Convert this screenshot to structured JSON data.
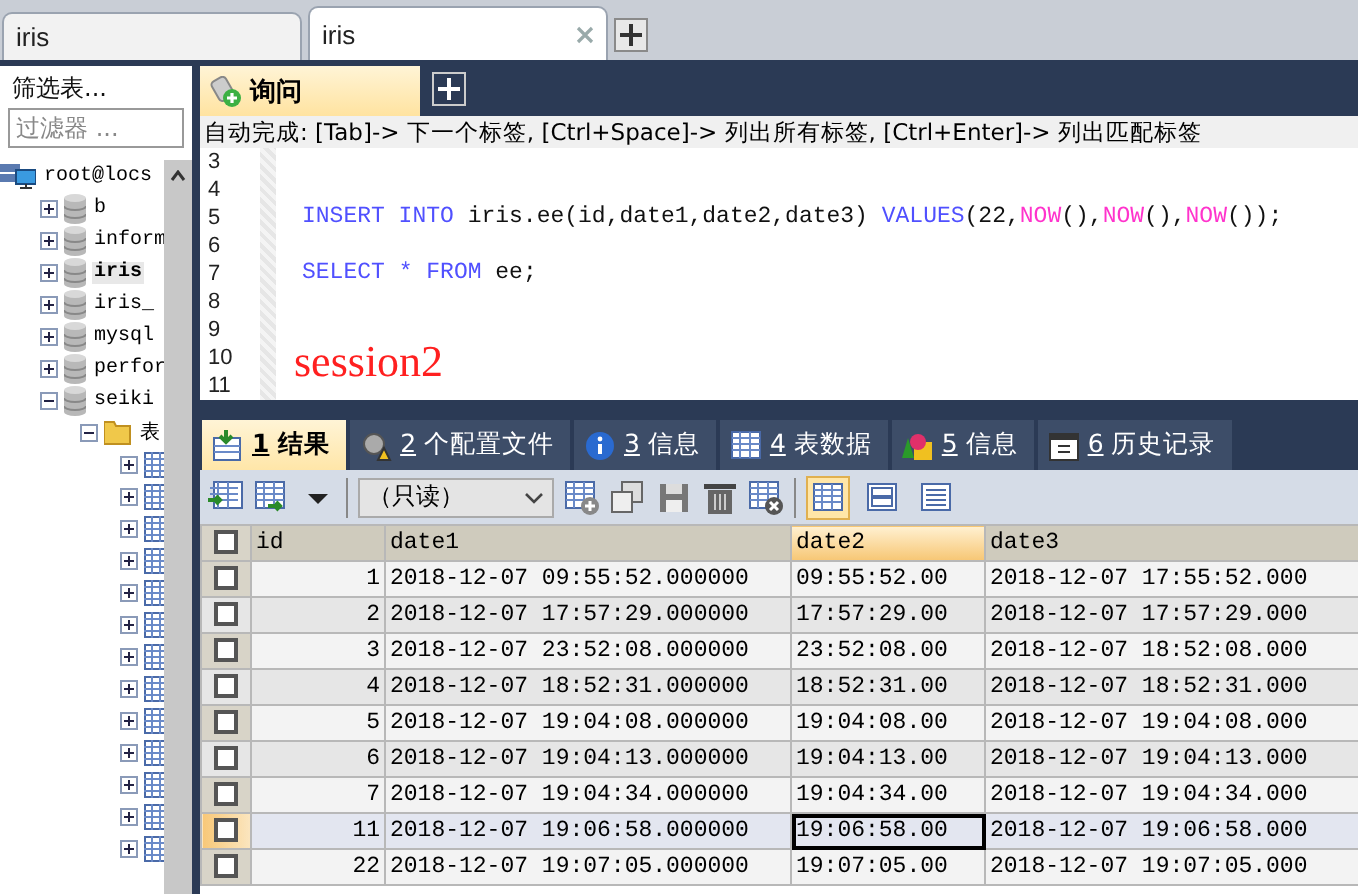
{
  "window_tabs": [
    {
      "label": "iris",
      "selected": false
    },
    {
      "label": "iris",
      "selected": true
    }
  ],
  "sidebar": {
    "title": "筛选表...",
    "filter": {
      "placeholder": "过滤器 ..."
    },
    "tree": [
      {
        "kind": "server",
        "label": "root@locs",
        "children": [
          {
            "kind": "database",
            "label": "b",
            "expanded": false,
            "selected": false
          },
          {
            "kind": "database",
            "label": "inform",
            "expanded": false,
            "selected": false
          },
          {
            "kind": "database",
            "label": "iris",
            "expanded": false,
            "selected": true
          },
          {
            "kind": "database",
            "label": "iris_",
            "expanded": false,
            "selected": false
          },
          {
            "kind": "database",
            "label": "mysql",
            "expanded": false,
            "selected": false
          },
          {
            "kind": "database",
            "label": "perfor",
            "expanded": false,
            "selected": false
          },
          {
            "kind": "database",
            "label": "seiki",
            "expanded": true,
            "selected": false,
            "children": [
              {
                "kind": "folder",
                "label": "表",
                "expanded": true,
                "children": [
                  {
                    "kind": "table",
                    "expanded": false
                  },
                  {
                    "kind": "table",
                    "expanded": false
                  },
                  {
                    "kind": "table",
                    "expanded": false
                  },
                  {
                    "kind": "table",
                    "expanded": false
                  },
                  {
                    "kind": "table",
                    "expanded": false
                  },
                  {
                    "kind": "table",
                    "expanded": false
                  },
                  {
                    "kind": "table",
                    "expanded": false
                  },
                  {
                    "kind": "table",
                    "expanded": false
                  },
                  {
                    "kind": "table",
                    "expanded": false
                  },
                  {
                    "kind": "table",
                    "expanded": false
                  },
                  {
                    "kind": "table",
                    "expanded": false
                  },
                  {
                    "kind": "table",
                    "expanded": false
                  },
                  {
                    "kind": "table",
                    "expanded": false
                  }
                ]
              }
            ]
          }
        ]
      }
    ]
  },
  "query_tabs": [
    {
      "label": "询问",
      "selected": true
    }
  ],
  "autocomplete_hint": "自动完成: [Tab]-> 下一个标签, [Ctrl+Space]-> 列出所有标签, [Ctrl+Enter]-> 列出匹配标签",
  "editor": {
    "lines": [
      {
        "number": "3"
      },
      {
        "number": "4"
      },
      {
        "number": "5",
        "tokens": [
          {
            "kind": "keyword",
            "text": "INSERT INTO"
          },
          {
            "kind": "plain",
            "text": " iris.ee(id,date1,date2,date3) "
          },
          {
            "kind": "keyword",
            "text": "VALUES"
          },
          {
            "kind": "plain",
            "text": "(22,"
          },
          {
            "kind": "function",
            "text": "NOW"
          },
          {
            "kind": "plain",
            "text": "(),"
          },
          {
            "kind": "function",
            "text": "NOW"
          },
          {
            "kind": "plain",
            "text": "(),"
          },
          {
            "kind": "function",
            "text": "NOW"
          },
          {
            "kind": "plain",
            "text": "());"
          }
        ]
      },
      {
        "number": "6"
      },
      {
        "number": "7",
        "tokens": [
          {
            "kind": "keyword",
            "text": "SELECT"
          },
          {
            "kind": "operator",
            "text": " *"
          },
          {
            "kind": "keyword",
            "text": " FROM"
          },
          {
            "kind": "plain",
            "text": " ee;"
          }
        ]
      },
      {
        "number": "8"
      },
      {
        "number": "9"
      },
      {
        "number": "10"
      },
      {
        "number": "11"
      }
    ],
    "annotation": "session2"
  },
  "result_tabs": [
    {
      "kind": "result",
      "key": "1",
      "label": "结果",
      "selected": true
    },
    {
      "kind": "profile",
      "key": "2",
      "label": "个配置文件",
      "selected": false
    },
    {
      "kind": "info",
      "key": "3",
      "label": "信息",
      "selected": false
    },
    {
      "kind": "tabledata",
      "key": "4",
      "label": "表数据",
      "selected": false
    },
    {
      "kind": "info2",
      "key": "5",
      "label": "信息",
      "selected": false
    },
    {
      "kind": "history",
      "key": "6",
      "label": "历史记录",
      "selected": false
    }
  ],
  "toolbar": {
    "mode": "（只读）",
    "views": [
      {
        "kind": "grid",
        "selected": true
      },
      {
        "kind": "form",
        "selected": false
      },
      {
        "kind": "text",
        "selected": false
      }
    ]
  },
  "table": {
    "select_all": {
      "checked": false
    },
    "columns": [
      {
        "label": "id",
        "selected": false
      },
      {
        "label": "date1",
        "selected": false
      },
      {
        "label": "date2",
        "selected": true
      },
      {
        "label": "date3",
        "selected": false
      }
    ],
    "rows": [
      {
        "checked": false,
        "selected": false,
        "cells": [
          "1",
          "2018-12-07 09:55:52.000000",
          "09:55:52.00",
          "2018-12-07 17:55:52.000"
        ]
      },
      {
        "checked": false,
        "selected": false,
        "cells": [
          "2",
          "2018-12-07 17:57:29.000000",
          "17:57:29.00",
          "2018-12-07 17:57:29.000"
        ]
      },
      {
        "checked": false,
        "selected": false,
        "cells": [
          "3",
          "2018-12-07 23:52:08.000000",
          "23:52:08.00",
          "2018-12-07 18:52:08.000"
        ]
      },
      {
        "checked": false,
        "selected": false,
        "cells": [
          "4",
          "2018-12-07 18:52:31.000000",
          "18:52:31.00",
          "2018-12-07 18:52:31.000"
        ]
      },
      {
        "checked": false,
        "selected": false,
        "cells": [
          "5",
          "2018-12-07 19:04:08.000000",
          "19:04:08.00",
          "2018-12-07 19:04:08.000"
        ]
      },
      {
        "checked": false,
        "selected": false,
        "cells": [
          "6",
          "2018-12-07 19:04:13.000000",
          "19:04:13.00",
          "2018-12-07 19:04:13.000"
        ]
      },
      {
        "checked": false,
        "selected": false,
        "cells": [
          "7",
          "2018-12-07 19:04:34.000000",
          "19:04:34.00",
          "2018-12-07 19:04:34.000"
        ]
      },
      {
        "checked": false,
        "selected": true,
        "cells": [
          "11",
          "2018-12-07 19:06:58.000000",
          "19:06:58.00",
          "2018-12-07 19:06:58.000"
        ]
      },
      {
        "checked": false,
        "selected": false,
        "cells": [
          "22",
          "2018-12-07 19:07:05.000000",
          "19:07:05.00",
          "2018-12-07 19:07:05.000"
        ]
      }
    ]
  }
}
